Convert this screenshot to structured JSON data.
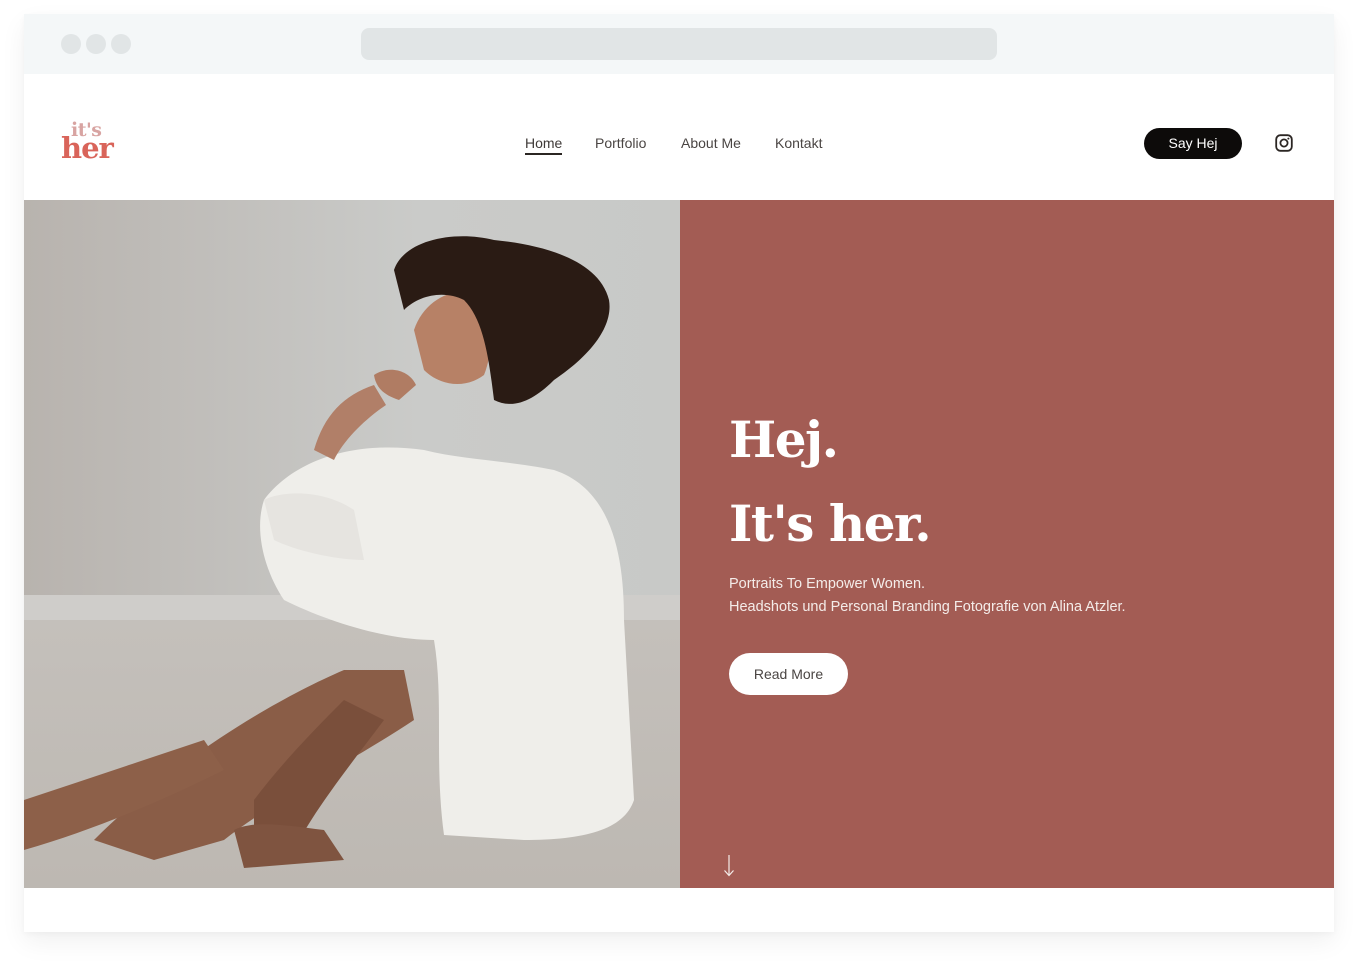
{
  "browser": {
    "window_controls": [
      "close",
      "minimize",
      "maximize"
    ],
    "address_bar": ""
  },
  "header": {
    "logo": {
      "line1": "it's",
      "line2": "her",
      "colors": {
        "line1": "#d8a4a2",
        "line2": "#d9645a"
      }
    },
    "nav": [
      {
        "label": "Home",
        "active": true
      },
      {
        "label": "Portfolio",
        "active": false
      },
      {
        "label": "About Me",
        "active": false
      },
      {
        "label": "Kontakt",
        "active": false
      }
    ],
    "cta_label": "Say Hej",
    "social_icon": "instagram-icon"
  },
  "hero": {
    "image_alt": "Portrait of a woman with curly hair in a white shirt sitting on the floor",
    "heading_line1": "Hej.",
    "heading_line2": "It's her.",
    "subtitle_line1": "Portraits To Empower Women.",
    "subtitle_line2": "Headshots und Personal Branding Fotografie von Alina Atzler.",
    "button_label": "Read More",
    "scroll_icon": "arrow-down-icon",
    "panel_color": "#a35c54"
  }
}
